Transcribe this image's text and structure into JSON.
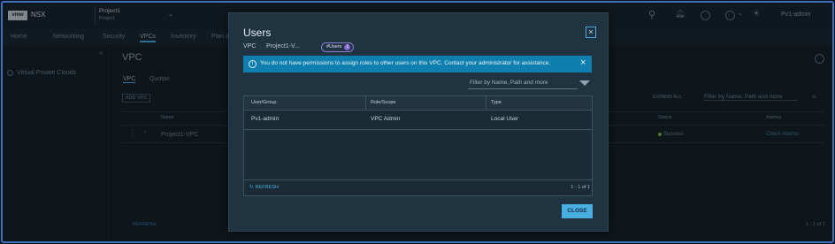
{
  "app": {
    "logo_text": "vmw",
    "product": "NSX",
    "project_name": "Project1",
    "project_sub": "Project",
    "user": "Pv1-admin"
  },
  "nav": {
    "tabs": [
      "Home",
      "Networking",
      "Security",
      "VPCs",
      "Inventory",
      "Plan & Troubleshoot"
    ]
  },
  "sidebar": {
    "items": [
      {
        "label": "Virtual Private Clouds"
      }
    ]
  },
  "page": {
    "title": "VPC",
    "tabs": [
      "VPC",
      "Quotas"
    ],
    "add_button": "ADD VPC",
    "expand_all": "EXPAND ALL",
    "filter_placeholder": "Filter by Name, Path and more",
    "columns": [
      "Name",
      "Status",
      "Alarms"
    ],
    "rows": [
      {
        "name": "Project1-VPC",
        "status": "Success",
        "alarms": "Check Alarms"
      }
    ],
    "refresh": "REFRESH",
    "pagination": "1 - 1 of 1"
  },
  "modal": {
    "title": "Users",
    "context_label": "VPC",
    "context_value": "Project1-V...",
    "badge_label": "#Users",
    "badge_count": "1",
    "alert_text": "You do not have permissions to assign roles to other users on this VPC. Contact your administrator for assistance.",
    "filter_placeholder": "Filter by Name, Path and more",
    "table": {
      "columns": [
        "User/Group",
        "Role/Scope",
        "Type"
      ],
      "rows": [
        {
          "user": "Pv1-admin",
          "role": "VPC Admin",
          "type": "Local User"
        }
      ]
    },
    "refresh": "REFRESH",
    "pagination": "1 - 1 of 1",
    "close_button": "CLOSE"
  },
  "colors": {
    "accent": "#49aee0",
    "alert_bg": "#0e7fae",
    "badge_border": "#8e7ad8",
    "modal_bg": "#203341",
    "success": "#7ab648"
  }
}
